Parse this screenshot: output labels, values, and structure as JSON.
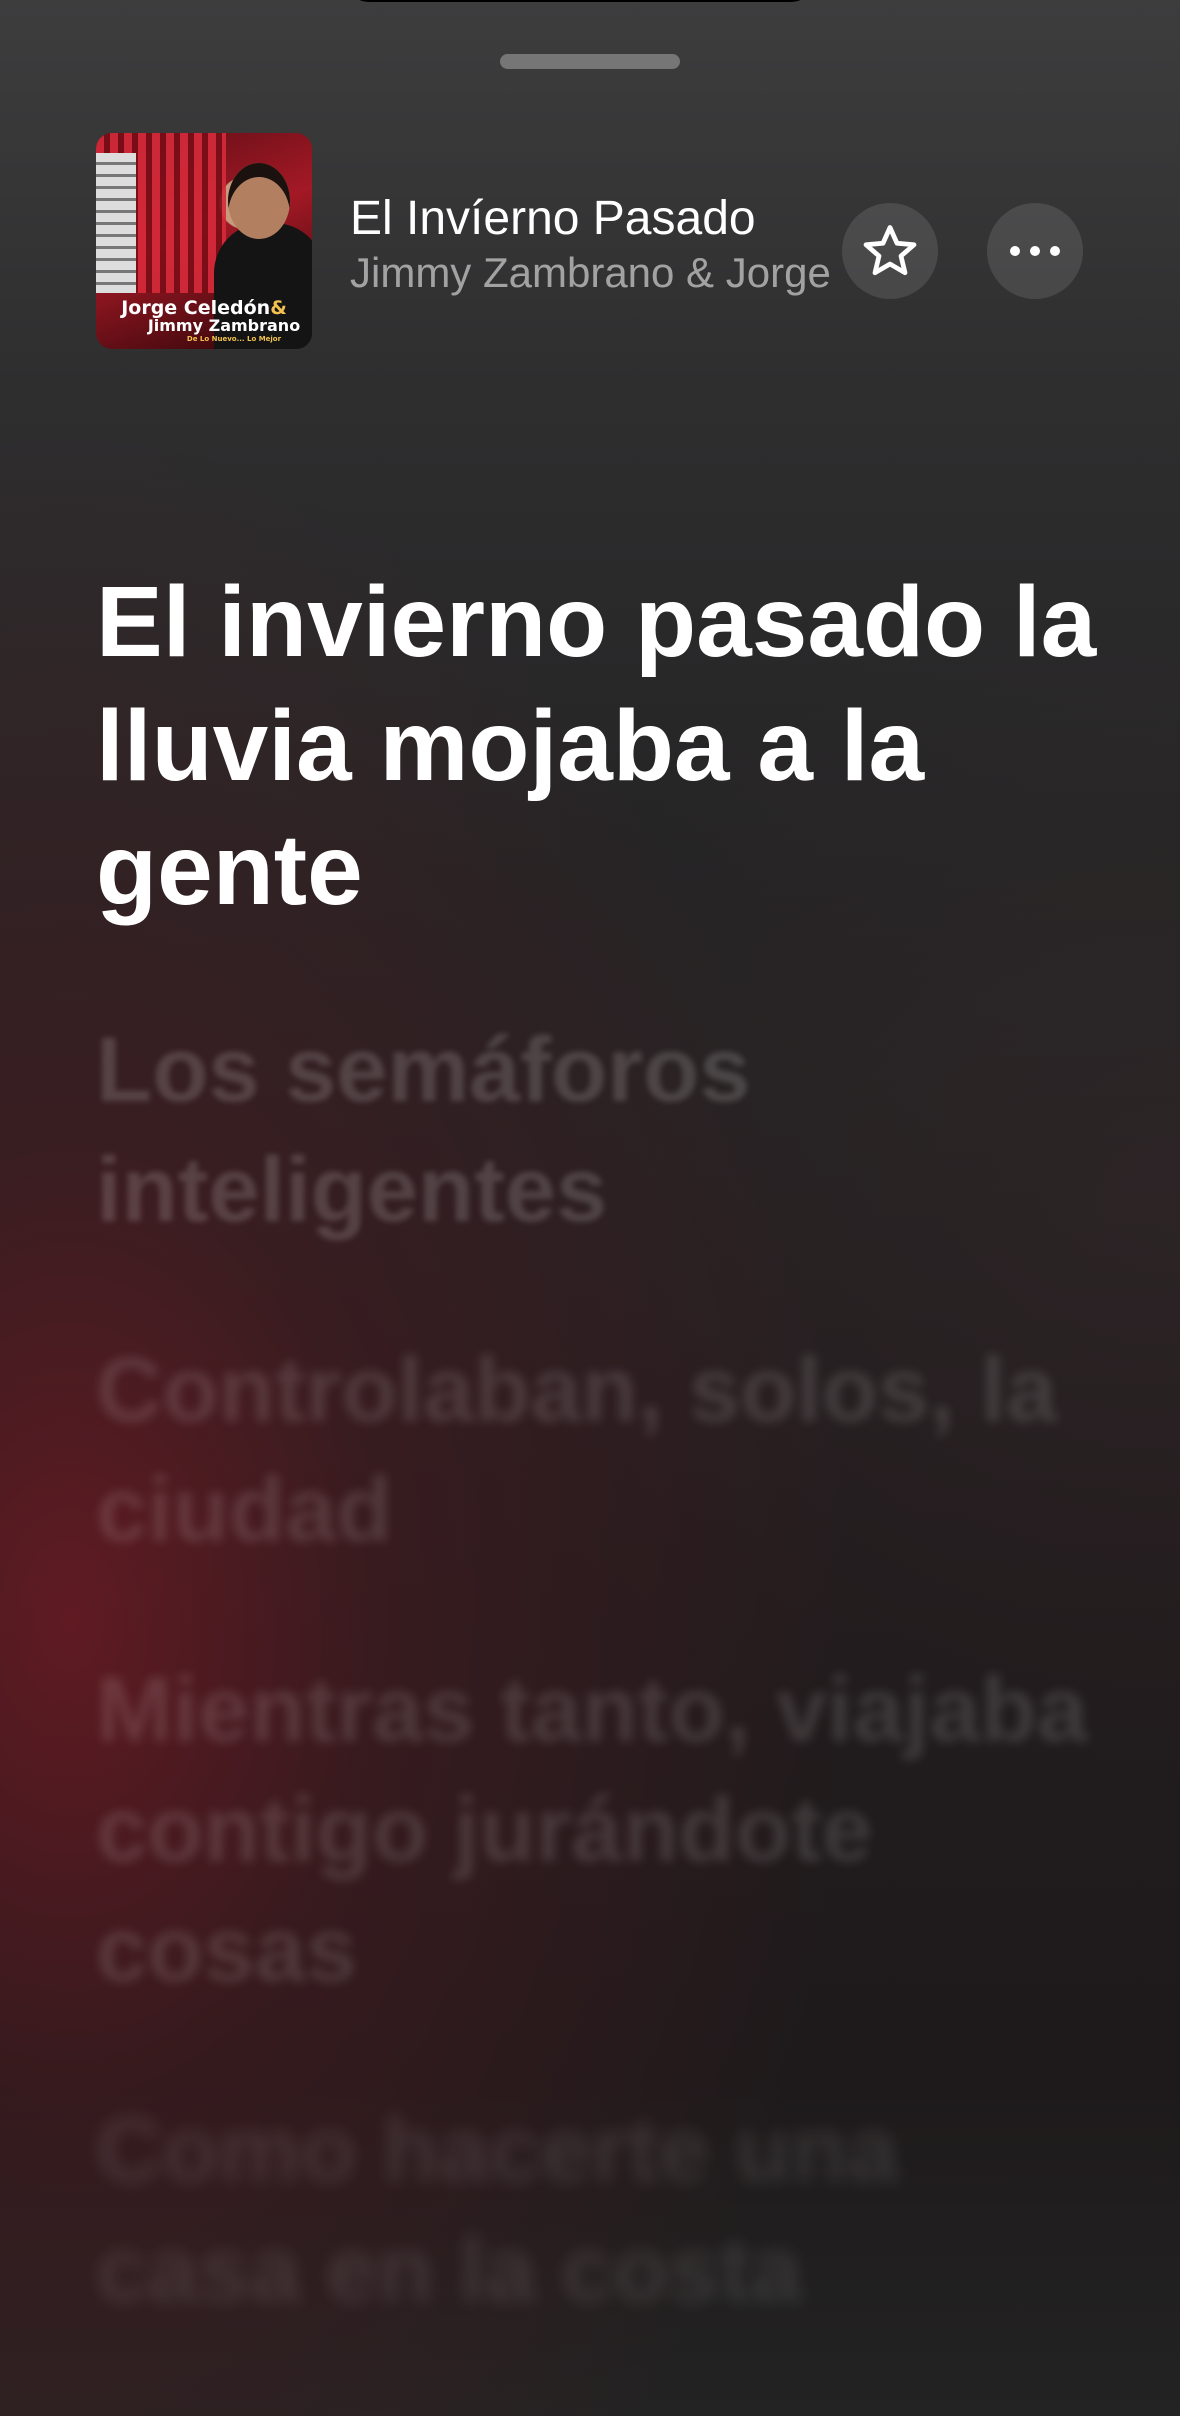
{
  "now_playing": {
    "title": "El Invíerno Pasado",
    "artist": "Jimmy Zambrano & Jorge Celedón",
    "artwork_text": {
      "line1": "Jorge Celedón",
      "amp": "&",
      "line2": "Jimmy Zambrano",
      "line3": "De Lo Nuevo... Lo Mejor"
    }
  },
  "actions": {
    "favorite_icon": "star-outline-icon",
    "more_icon": "ellipsis-icon"
  },
  "lyrics": {
    "current": "El invierno pasado la lluvia mojaba a la gente",
    "upcoming": [
      "Los semáforos inteligentes",
      "Controlaban, solos, la ciudad",
      "Mientras tanto, viajaba contigo jurándote cosas",
      "Como hacerte una casa en la costa"
    ]
  },
  "colors": {
    "accent_background": "#7a1a24",
    "text_primary": "#ffffff"
  }
}
